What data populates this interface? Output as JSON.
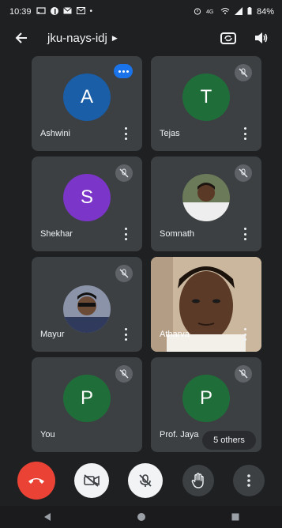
{
  "status_bar": {
    "time": "10:39",
    "battery": "84%",
    "left_icons": [
      "cast-icon",
      "facebook-icon",
      "mail-icon",
      "mail-icon",
      "dot-icon"
    ],
    "right_icons": [
      "alarm-icon",
      "network-icon",
      "wifi-icon",
      "signal-icon",
      "battery-icon"
    ]
  },
  "header": {
    "title": "jku-nays-idj",
    "actions": [
      "switch-camera-icon",
      "speaker-icon"
    ]
  },
  "participants": [
    {
      "name": "Ashwini",
      "initial": "A",
      "avatar_color": "#1a5ea8",
      "mic_state": "speaking"
    },
    {
      "name": "Tejas",
      "initial": "T",
      "avatar_color": "#1f6e3a",
      "mic_state": "muted"
    },
    {
      "name": "Shekhar",
      "initial": "S",
      "avatar_color": "#7b35c8",
      "mic_state": "muted"
    },
    {
      "name": "Somnath",
      "initial": "",
      "avatar_color": "#5a4033",
      "mic_state": "muted",
      "photo": true
    },
    {
      "name": "Mayur",
      "initial": "",
      "avatar_color": "#4b5563",
      "mic_state": "muted",
      "photo": true
    },
    {
      "name": "Atharva",
      "initial": "",
      "avatar_color": "#c9b9a3",
      "mic_state": "none",
      "video": true
    },
    {
      "name": "You",
      "initial": "P",
      "avatar_color": "#1f6e3a",
      "mic_state": "muted"
    },
    {
      "name": "Prof. Jaya",
      "initial": "P",
      "avatar_color": "#1f6e3a",
      "mic_state": "muted"
    }
  ],
  "others_label": "5 others",
  "controls": [
    "end-call",
    "camera-off",
    "mic-off",
    "raise-hand",
    "more-options"
  ],
  "nav": [
    "back",
    "home",
    "recents"
  ]
}
